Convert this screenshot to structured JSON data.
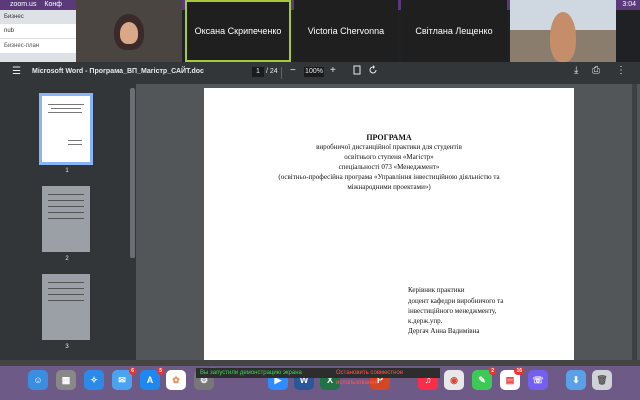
{
  "menubar": {
    "apple": "",
    "app": "zoom.us",
    "menu": "Конф",
    "time": "3:04"
  },
  "browser": {
    "tab": "Бизнес",
    "url": "nub",
    "bookmark": "Бизнес-план"
  },
  "participants": [
    {
      "name": "Оксана Скрипеченко"
    },
    {
      "name": "Victoria Chervonna"
    },
    {
      "name": "Світлана Лещенко"
    }
  ],
  "viewer": {
    "menu_icon": "☰",
    "title": "Microsoft Word - Програма_ВП_Магістр_САЙТ.doc",
    "page_current": "1",
    "page_sep": "/",
    "page_total": "24",
    "zoom": "100%",
    "zoom_out": "−",
    "zoom_in": "+",
    "download": "⤓",
    "print": "⎙",
    "more": "⋮"
  },
  "thumbnails": [
    "1",
    "2",
    "3"
  ],
  "document": {
    "heading": "ПРОГРАМА",
    "lines": [
      "виробничої дистанційної практики для студентів",
      "освітнього ступеня «Магістр»",
      "спеціальності 073 «Менеджмент»",
      "(освітньо-професійна програма «Управління інвестиційною діяльністю та",
      "міжнародними проектами»)"
    ],
    "signature": [
      "Керівник практики",
      "доцент кафедри виробничого та",
      "інвестиційного менеджменту,",
      "к.держ.упр.",
      "Дергач Анна Вадимівна"
    ]
  },
  "banners": {
    "sharing": "Вы запустили демонстрацию экрана",
    "stop": "Остановить совместное использование"
  },
  "dock": {
    "badges": [
      "6",
      "5",
      "10",
      "2",
      "16"
    ],
    "icons": [
      "finder-icon",
      "launchpad-icon",
      "safari-icon",
      "mail-icon",
      "appstore-icon",
      "photos-icon",
      "settings-icon",
      "zoom-icon",
      "word-icon",
      "excel-icon",
      "powerpoint-icon",
      "music-icon",
      "chrome-icon",
      "messages-icon",
      "calendar-icon",
      "viber-icon",
      "folder-icon",
      "trash-icon"
    ]
  }
}
